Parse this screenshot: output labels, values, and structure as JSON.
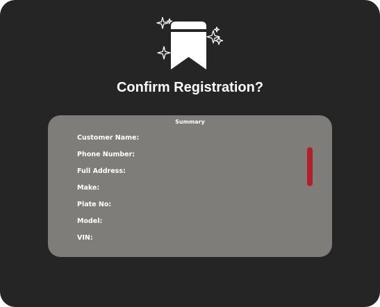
{
  "dialog": {
    "title": "Confirm Registration?",
    "icon": "bookmark-sparkle-icon"
  },
  "summary": {
    "heading": "Summary",
    "fields": [
      {
        "label": "Customer Name:"
      },
      {
        "label": "Phone Number:"
      },
      {
        "label": "Full Address:"
      },
      {
        "label": "Make:"
      },
      {
        "label": "Plate No:"
      },
      {
        "label": "Model:"
      },
      {
        "label": "VIN:"
      }
    ]
  },
  "colors": {
    "background": "#252525",
    "panel": "#7f7d7a",
    "scrollbar_thumb": "#b0212e",
    "text": "#ffffff"
  }
}
